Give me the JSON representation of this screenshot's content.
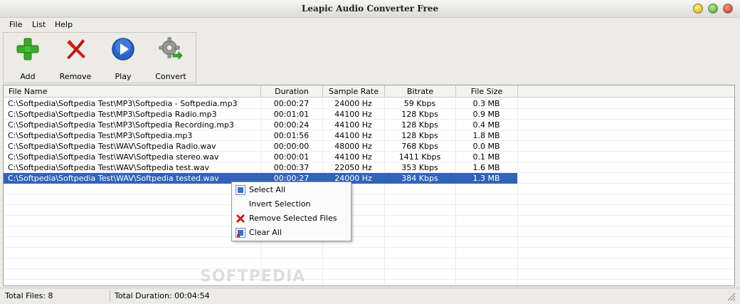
{
  "window": {
    "title": "Leapic Audio Converter Free"
  },
  "menu": {
    "items": [
      "File",
      "List",
      "Help"
    ]
  },
  "toolbar": {
    "add_label": "Add",
    "remove_label": "Remove",
    "play_label": "Play",
    "convert_label": "Convert"
  },
  "table": {
    "columns": [
      "File Name",
      "Duration",
      "Sample Rate",
      "Bitrate",
      "File Size"
    ],
    "rows": [
      [
        "C:\\Softpedia\\Softpedia Test\\MP3\\Softpedia - Softpedia.mp3",
        "00:00:27",
        "24000 Hz",
        "59 Kbps",
        "0.3 MB"
      ],
      [
        "C:\\Softpedia\\Softpedia Test\\MP3\\Softpedia Radio.mp3",
        "00:01:01",
        "44100 Hz",
        "128 Kbps",
        "0.9 MB"
      ],
      [
        "C:\\Softpedia\\Softpedia Test\\MP3\\Softpedia Recording.mp3",
        "00:00:24",
        "44100 Hz",
        "128 Kbps",
        "0.4 MB"
      ],
      [
        "C:\\Softpedia\\Softpedia Test\\MP3\\Softpedia.mp3",
        "00:01:56",
        "44100 Hz",
        "128 Kbps",
        "1.8 MB"
      ],
      [
        "C:\\Softpedia\\Softpedia Test\\WAV\\Softpedia Radio.wav",
        "00:00:00",
        "48000 Hz",
        "768 Kbps",
        "0.0 MB"
      ],
      [
        "C:\\Softpedia\\Softpedia Test\\WAV\\Softpedia stereo.wav",
        "00:00:01",
        "44100 Hz",
        "1411 Kbps",
        "0.1 MB"
      ],
      [
        "C:\\Softpedia\\Softpedia Test\\WAV\\Softpedia test.wav",
        "00:00:37",
        "22050 Hz",
        "353 Kbps",
        "1.6 MB"
      ],
      [
        "C:\\Softpedia\\Softpedia Test\\WAV\\Softpedia tested.wav",
        "00:00:27",
        "24000 Hz",
        "384 Kbps",
        "1.3 MB"
      ]
    ],
    "selected_row": 7
  },
  "watermark": "SOFTPEDIA",
  "context_menu": {
    "items": [
      "Select All",
      "Invert Selection",
      "Remove Selected Files",
      "Clear All"
    ]
  },
  "status": {
    "total_files": "Total Files: 8",
    "total_duration": "Total Duration: 00:04:54"
  },
  "colors": {
    "selection": "#3163b9",
    "add_icon": "#3aaa28",
    "remove_icon": "#d0201a",
    "play_icon": "#2a64c8"
  },
  "icons": {
    "add": "plus-icon",
    "remove": "x-mark-icon",
    "play": "play-icon",
    "convert": "gear-icon"
  }
}
